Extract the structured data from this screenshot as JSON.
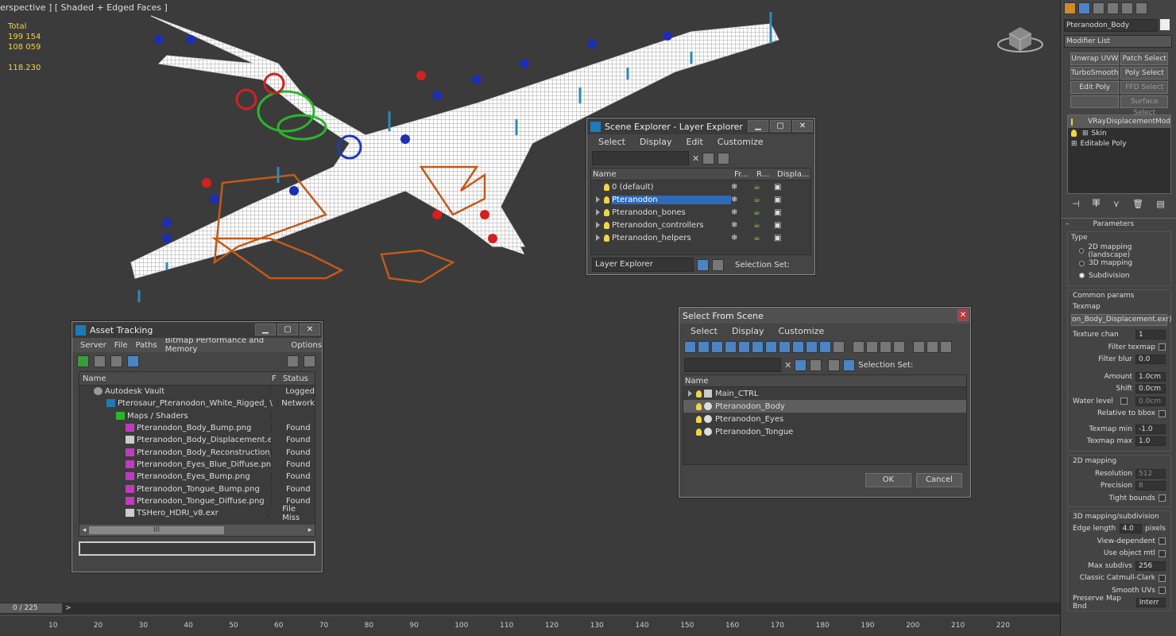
{
  "viewport": {
    "label": "erspective ] [ Shaded + Edged Faces ]",
    "stats": {
      "total_label": "Total",
      "polys": "199 154",
      "verts": "108 059",
      "fps": "118.230"
    }
  },
  "scene_explorer": {
    "title": "Scene Explorer - Layer Explorer",
    "menu": [
      "Select",
      "Display",
      "Edit",
      "Customize"
    ],
    "columns": [
      "Name",
      "Fr...",
      "R...",
      "Displa..."
    ],
    "rows": [
      "0 (default)",
      "Pteranodon",
      "Pteranodon_bones",
      "Pteranodon_controllers",
      "Pteranodon_helpers"
    ],
    "footer_dropdown": "Layer Explorer",
    "selection_set": "Selection Set:"
  },
  "asset_tracking": {
    "title": "Asset Tracking",
    "menu": [
      "Server",
      "File",
      "Paths",
      "Bitmap Performance and Memory",
      "Options"
    ],
    "columns": [
      "Name",
      "F",
      "Status"
    ],
    "rows": [
      {
        "name": "Autodesk Vault",
        "f": "",
        "status": "Logged"
      },
      {
        "name": "Pterosaur_Pteranodon_White_Rigged_vray....",
        "f": "\\",
        "status": "Network"
      },
      {
        "name": "Maps / Shaders",
        "f": "",
        "status": ""
      },
      {
        "name": "Pteranodon_Body_Bump.png",
        "f": "",
        "status": "Found"
      },
      {
        "name": "Pteranodon_Body_Displacement.exr",
        "f": "",
        "status": "Found"
      },
      {
        "name": "Pteranodon_Body_Reconstruction_Dif...",
        "f": "",
        "status": "Found"
      },
      {
        "name": "Pteranodon_Eyes_Blue_Diffuse.png",
        "f": "",
        "status": "Found"
      },
      {
        "name": "Pteranodon_Eyes_Bump.png",
        "f": "",
        "status": "Found"
      },
      {
        "name": "Pteranodon_Tongue_Bump.png",
        "f": "",
        "status": "Found"
      },
      {
        "name": "Pteranodon_Tongue_Diffuse.png",
        "f": "",
        "status": "Found"
      },
      {
        "name": "TSHero_HDRI_v8.exr",
        "f": "",
        "status": "File Miss"
      }
    ],
    "scroll_thumb": "III"
  },
  "select_from_scene": {
    "title": "Select From Scene",
    "menu": [
      "Select",
      "Display",
      "Customize"
    ],
    "selection_set": "Selection Set:",
    "column": "Name",
    "rows": [
      "Main_CTRL",
      "Pteranodon_Body",
      "Pteranodon_Eyes",
      "Pteranodon_Tongue"
    ],
    "ok": "OK",
    "cancel": "Cancel"
  },
  "command_panel": {
    "object_name": "Pteranodon_Body",
    "modifier_list": "Modifier List",
    "buttons": [
      "Unwrap UVW",
      "Patch Select",
      "TurboSmooth",
      "Poly Select",
      "Edit Poly",
      "FFD Select",
      "",
      "Surface Select"
    ],
    "stack": [
      "VRayDisplacementMod",
      "Skin",
      "Editable Poly"
    ],
    "parameters": "Parameters",
    "type_label": "Type",
    "types": [
      "2D mapping (landscape)",
      "3D mapping",
      "Subdivision"
    ],
    "common_params": "Common params",
    "texmap_label": "Texmap",
    "texmap_value": "on_Body_Displacement.exr)",
    "texture_chan": {
      "label": "Texture chan",
      "value": "1"
    },
    "filter_texmap": "Filter texmap",
    "filter_blur": {
      "label": "Filter blur",
      "value": "0.0"
    },
    "amount": {
      "label": "Amount",
      "value": "1.0cm"
    },
    "shift": {
      "label": "Shift",
      "value": "0.0cm"
    },
    "water_level": {
      "label": "Water level",
      "value": "0.0cm"
    },
    "relative_bbox": "Relative to bbox",
    "texmap_min": {
      "label": "Texmap min",
      "value": "-1.0"
    },
    "texmap_max": {
      "label": "Texmap max",
      "value": "1.0"
    },
    "mapping2d": "2D mapping",
    "resolution": {
      "label": "Resolution",
      "value": "512"
    },
    "precision": {
      "label": "Precision",
      "value": "8"
    },
    "tight_bounds": "Tight bounds",
    "mapping3d": "3D mapping/subdivision",
    "edge_length": {
      "label": "Edge length",
      "value": "4.0",
      "unit": "pixels"
    },
    "view_dependent": "View-dependent",
    "use_object_mtl": "Use object mtl",
    "max_subdivs": {
      "label": "Max subdivs",
      "value": "256"
    },
    "classic_cc": "Classic Catmull-Clark",
    "smooth_uvs": "Smooth UVs",
    "preserve_map": {
      "label": "Preserve Map Bnd",
      "value": "Interr"
    }
  },
  "timeline": {
    "frame": "0 / 225",
    "ticks": [
      "10",
      "20",
      "30",
      "40",
      "50",
      "60",
      "70",
      "80",
      "90",
      "100",
      "110",
      "120",
      "130",
      "140",
      "150",
      "160",
      "170",
      "180",
      "190",
      "200",
      "210",
      "220"
    ]
  },
  "colors": {
    "accent": "#2d6ab8",
    "viewport_bg": "#3b3b3b",
    "stats": "#f2d14a"
  }
}
